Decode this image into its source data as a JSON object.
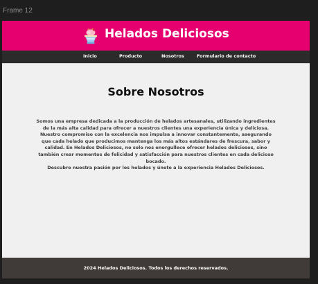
{
  "canvas": {
    "frame_label": "Frame 12"
  },
  "header": {
    "logo_icon": "ice-cream-sundae-icon",
    "brand": "Helados Deliciosos",
    "background": "#e6006f"
  },
  "nav": {
    "background": "#2b2b2b",
    "items": [
      {
        "label": "Inicio"
      },
      {
        "label": "Producto"
      },
      {
        "label": "Nosotros"
      },
      {
        "label": "Formulario de contacto"
      }
    ]
  },
  "main": {
    "title": "Sobre Nosotros",
    "paragraph_1": "Somos una empresa dedicada a la producción de helados artesanales, utilizando ingredientes de la más alta calidad para ofrecer a nuestros clientes una experiencia única y deliciosa. Nuestro compromiso con la excelencia nos impulsa a innovar constantemente, asegurando que cada helado que producimos mantenga los más altos estándares de frescura, sabor y calidad. En Helados Deliciosos, no solo nos enorgullece ofrecer helados deliciosos, sino también crear momentos de felicidad y satisfacción para nuestros clientes en cada delicioso bocado.",
    "paragraph_2": "Descubre nuestra pasión por los helados y únete a la experiencia Helados Deliciosos."
  },
  "footer": {
    "text": "2024 Helados Deliciosos. Todos los derechos reservados.",
    "background": "#403b39"
  }
}
